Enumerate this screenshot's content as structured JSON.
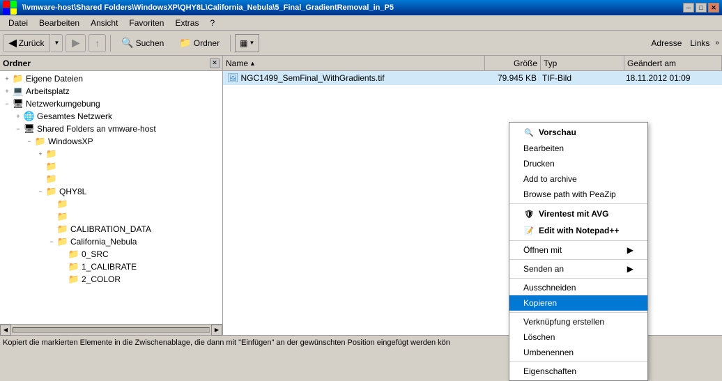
{
  "titlebar": {
    "title": "\\\\vmware-host\\Shared Folders\\WindowsXP\\QHY8L\\California_Nebula\\5_Final_GradientRemoval_in_P5",
    "minimize": "─",
    "restore": "□",
    "close": "✕"
  },
  "menubar": {
    "items": [
      {
        "label": "Datei"
      },
      {
        "label": "Bearbeiten"
      },
      {
        "label": "Ansicht"
      },
      {
        "label": "Favoriten"
      },
      {
        "label": "Extras"
      },
      {
        "label": "?"
      }
    ]
  },
  "toolbar": {
    "back_label": "Zurück",
    "search_label": "Suchen",
    "folder_label": "Ordner",
    "address_label": "Adresse",
    "links_label": "Links"
  },
  "left_panel": {
    "title": "Ordner",
    "tree": [
      {
        "id": "eigene",
        "indent": 0,
        "icon": "📁",
        "label": "Eigene Dateien",
        "expanded": false
      },
      {
        "id": "arbeitsplatz",
        "indent": 0,
        "icon": "💻",
        "label": "Arbeitsplatz",
        "expanded": false
      },
      {
        "id": "netzwerk",
        "indent": 0,
        "icon": "🖥",
        "label": "Netzwerkumgebung",
        "expanded": true
      },
      {
        "id": "gesamt",
        "indent": 1,
        "icon": "🌐",
        "label": "Gesamtes Netzwerk",
        "expanded": false
      },
      {
        "id": "shared",
        "indent": 1,
        "icon": "🖥",
        "label": "Shared Folders an vmware-host",
        "expanded": true
      },
      {
        "id": "winxp",
        "indent": 2,
        "icon": "📁",
        "label": "WindowsXP",
        "expanded": true
      },
      {
        "id": "f1",
        "indent": 3,
        "icon": "📁",
        "label": "",
        "expanded": false
      },
      {
        "id": "f2",
        "indent": 3,
        "icon": "📁",
        "label": "",
        "expanded": false
      },
      {
        "id": "f3",
        "indent": 3,
        "icon": "📁",
        "label": "",
        "expanded": false
      },
      {
        "id": "qhy8l",
        "indent": 3,
        "icon": "📁",
        "label": "QHY8L",
        "expanded": true
      },
      {
        "id": "f4",
        "indent": 4,
        "icon": "📁",
        "label": "",
        "expanded": false
      },
      {
        "id": "f5",
        "indent": 4,
        "icon": "📁",
        "label": "",
        "expanded": false
      },
      {
        "id": "calibration",
        "indent": 4,
        "icon": "📁",
        "label": "CALIBRATION_DATA",
        "expanded": false
      },
      {
        "id": "california",
        "indent": 4,
        "icon": "📁",
        "label": "California_Nebula",
        "expanded": true
      },
      {
        "id": "src",
        "indent": 5,
        "icon": "📁",
        "label": "0_SRC",
        "expanded": false
      },
      {
        "id": "calibrate",
        "indent": 5,
        "icon": "📁",
        "label": "1_CALIBRATE",
        "expanded": false
      },
      {
        "id": "color",
        "indent": 5,
        "icon": "📁",
        "label": "2_COLOR",
        "expanded": false
      }
    ]
  },
  "file_list": {
    "columns": [
      {
        "label": "Name",
        "sort_arrow": "▲"
      },
      {
        "label": "Größe"
      },
      {
        "label": "Typ"
      },
      {
        "label": "Geändert am"
      }
    ],
    "files": [
      {
        "name": "NGC1499_SemFinal_WithGradients.tif",
        "size": "79.945 KB",
        "type": "TIF-Bild",
        "date": "18.11.2012 01:09",
        "selected": true
      }
    ]
  },
  "context_menu": {
    "items": [
      {
        "type": "header",
        "label": "Vorschau",
        "icon": "🔍"
      },
      {
        "type": "item",
        "label": "Bearbeiten"
      },
      {
        "type": "item",
        "label": "Drucken"
      },
      {
        "type": "item",
        "label": "Add to archive"
      },
      {
        "type": "item",
        "label": "Browse path with PeaZip"
      },
      {
        "type": "separator"
      },
      {
        "type": "header",
        "label": "Virentest mit AVG",
        "icon": "🛡"
      },
      {
        "type": "header",
        "label": "Edit with Notepad++",
        "icon": "📝"
      },
      {
        "type": "separator"
      },
      {
        "type": "item",
        "label": "Öffnen mit",
        "sub": true
      },
      {
        "type": "separator"
      },
      {
        "type": "item",
        "label": "Senden an",
        "sub": true
      },
      {
        "type": "separator"
      },
      {
        "type": "item",
        "label": "Ausschneiden"
      },
      {
        "type": "item",
        "label": "Kopieren",
        "active": true
      },
      {
        "type": "separator"
      },
      {
        "type": "item",
        "label": "Verknüpfung erstellen"
      },
      {
        "type": "item",
        "label": "Löschen"
      },
      {
        "type": "item",
        "label": "Umbenennen"
      },
      {
        "type": "separator"
      },
      {
        "type": "item",
        "label": "Eigenschaften"
      }
    ]
  },
  "statusbar": {
    "text": "Kopiert die markierten Elemente in die Zwischenablage, die dann mit \"Einfügen\" an der gewünschten Position eingefügt werden kön"
  }
}
